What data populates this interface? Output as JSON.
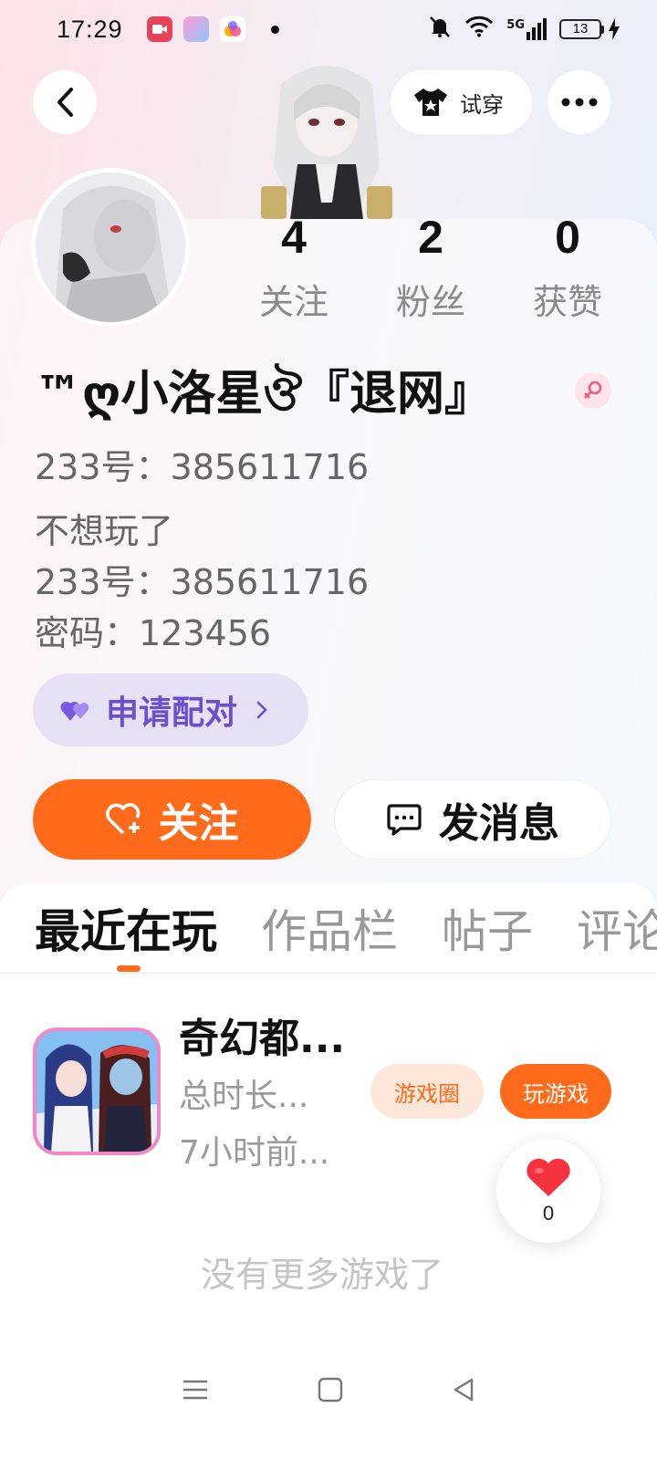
{
  "status_bar": {
    "time": "17:29",
    "network": "5G",
    "battery": "13"
  },
  "header": {
    "try_on_label": "试穿"
  },
  "stats": [
    {
      "value": "4",
      "label": "关注"
    },
    {
      "value": "2",
      "label": "粉丝"
    },
    {
      "value": "0",
      "label": "获赞"
    }
  ],
  "profile": {
    "nickname": "™ღ小洛星ঔ『退网』",
    "id_line": "233号：385611716",
    "bio": [
      "不想玩了",
      "233号：385611716",
      "密码：123456"
    ]
  },
  "actions": {
    "pair_label": "申请配对",
    "follow_label": "关注",
    "message_label": "发消息"
  },
  "tabs": [
    "最近在玩",
    "作品栏",
    "帖子",
    "评论"
  ],
  "recent_game": {
    "title": "奇幻都...",
    "play_time": "总时长...",
    "last_played": "7小时前...",
    "circle_label": "游戏圈",
    "play_label": "玩游戏"
  },
  "like": {
    "count": "0"
  },
  "empty_text": "没有更多游戏了",
  "colors": {
    "accent": "#ff6b1a",
    "pair_bg": "#e7e1f6",
    "pair_text": "#6a4fcf"
  }
}
